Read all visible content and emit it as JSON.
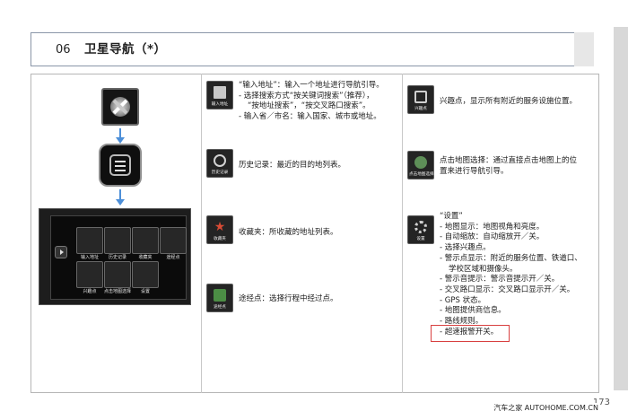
{
  "header": {
    "chapter_number": "06",
    "chapter_title": "卫星导航（*）"
  },
  "nav_screen": {
    "tiles": [
      "输入地址",
      "历史记录",
      "收藏夹",
      "途经点",
      "兴趣点",
      "点击地图选择",
      "设置"
    ]
  },
  "middle_column": {
    "entries": [
      {
        "icon_label": "输入地址",
        "lines": [
          "“输入地址”：输入一个地址进行导航引导。",
          "- 选择搜索方式“按关键词搜索”（推荐），",
          "“按地址搜索”，“按交叉路口搜索”。",
          "- 输入省／市名：输入国家、城市或地址。"
        ]
      },
      {
        "icon_label": "历史记录",
        "lines": [
          "历史记录：最近的目的地列表。"
        ]
      },
      {
        "icon_label": "收藏夹",
        "lines": [
          "收藏夹：所收藏的地址列表。"
        ]
      },
      {
        "icon_label": "途经点",
        "lines": [
          "途经点：选择行程中经过点。"
        ]
      }
    ]
  },
  "right_column": {
    "entries": [
      {
        "icon_label": "兴趣点",
        "lines": [
          "兴趣点，显示所有附近的服务设施位置。"
        ]
      },
      {
        "icon_label": "点击地图选择",
        "lines": [
          "点击地图选择：通过直接点击地图上的位",
          "置来进行导航引导。"
        ]
      },
      {
        "icon_label": "设置",
        "lines": [
          "“设置”",
          "- 地图显示：地图视角和亮度。",
          "- 自动缩放：自动缩放开／关。",
          "- 选择兴趣点。",
          "- 警示点显示：附近的服务位置、铁道口、",
          "学校区域和摄像头。",
          "- 警示音提示：警示音提示开／关。",
          "- 交叉路口显示：交叉路口显示开／关。",
          "- GPS 状态。",
          "- 地图提供商信息。",
          "- 路线规则。",
          "- 超速报警开关。"
        ]
      }
    ]
  },
  "page_number": "173",
  "footer": {
    "brand_text": "汽车之家 AUTOHOME.COM.CN"
  },
  "colors": {
    "arrow_blue": "#4d8fd8",
    "highlight_red": "#d84040"
  }
}
